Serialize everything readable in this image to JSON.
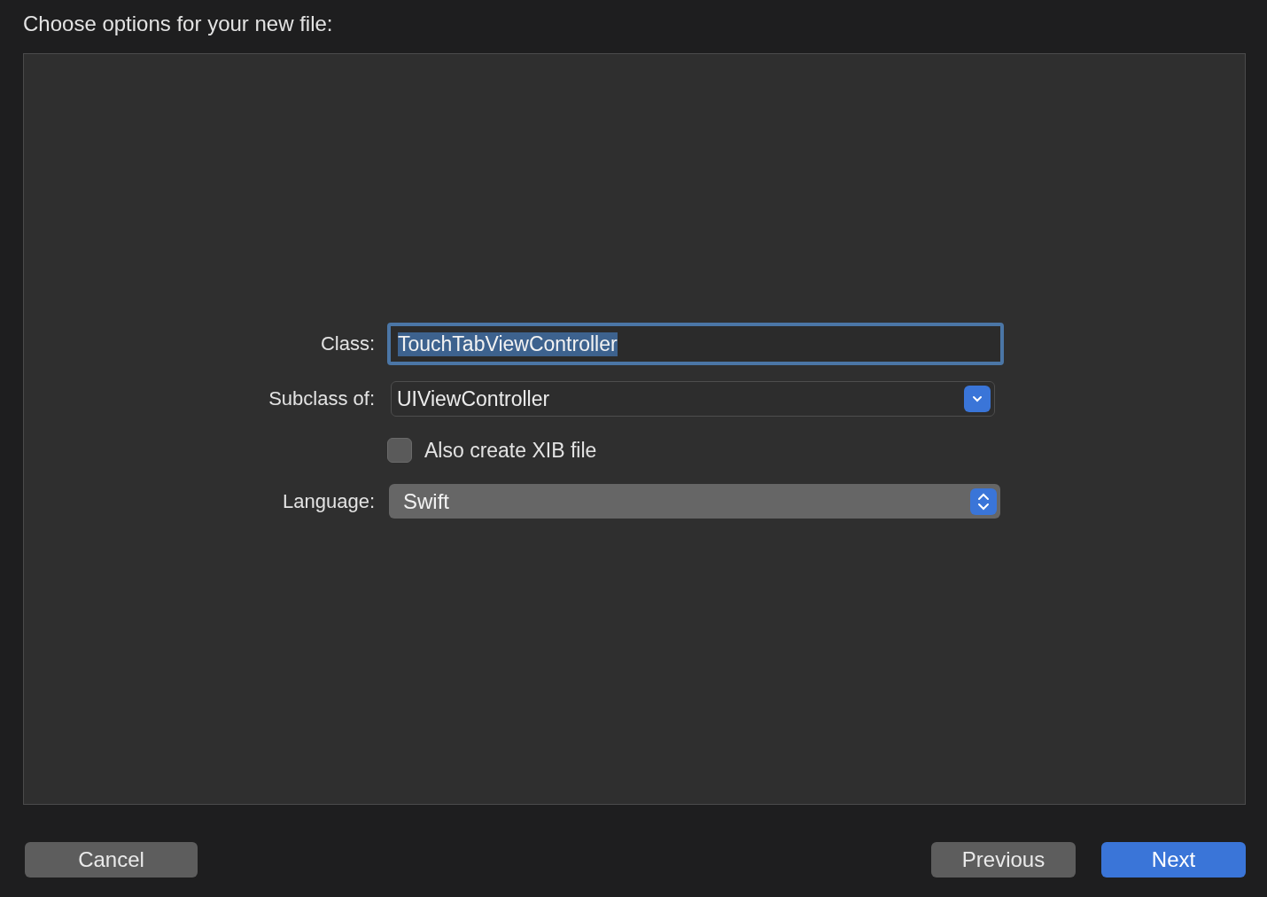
{
  "header": "Choose options for your new file:",
  "form": [
    {
      "kind": "text",
      "label": "Class:",
      "value": "TouchTabViewController",
      "focused": true,
      "text_selected": true
    },
    {
      "kind": "combo",
      "label": "Subclass of:",
      "value": "UIViewController"
    },
    {
      "kind": "checkbox",
      "label": "Also create XIB file",
      "checked": false
    },
    {
      "kind": "popup",
      "label": "Language:",
      "value": "Swift"
    }
  ],
  "buttons_left": [
    {
      "label": "Cancel",
      "kind": "normal"
    }
  ],
  "buttons_right": [
    {
      "label": "Previous",
      "kind": "normal"
    },
    {
      "label": "Next",
      "kind": "default"
    }
  ]
}
